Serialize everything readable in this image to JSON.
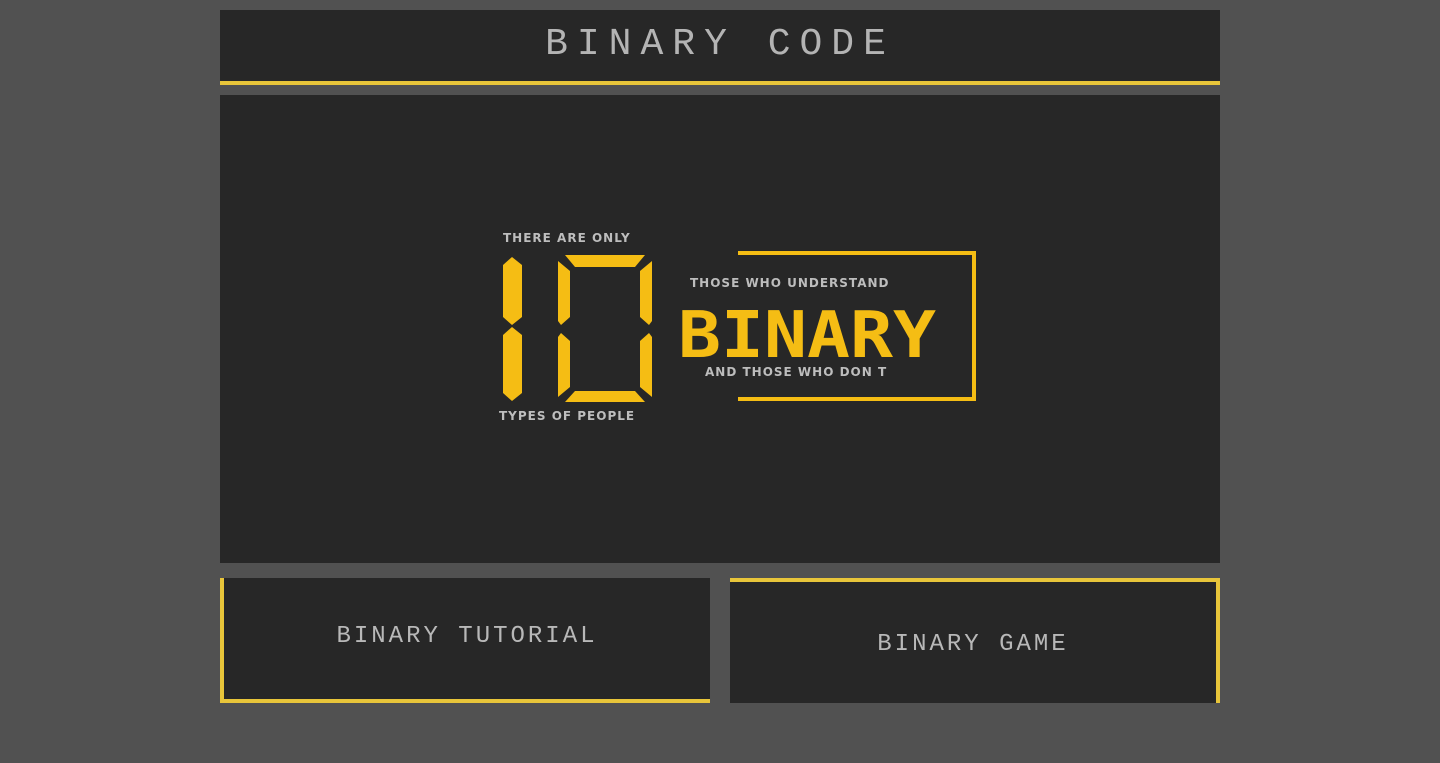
{
  "header": {
    "title": "BINARY CODE"
  },
  "hero": {
    "top_line": "THERE ARE ONLY",
    "big_number": "10",
    "bottom_line": "TYPES OF PEOPLE",
    "box_top": "THOSE WHO UNDERSTAND",
    "box_word": "BINARY",
    "box_bottom": "AND THOSE WHO DON T"
  },
  "buttons": {
    "tutorial": "BINARY TUTORIAL",
    "game": "BINARY GAME"
  },
  "colors": {
    "background": "#515151",
    "panel": "#272727",
    "accent": "#e8c53a",
    "lcd_yellow": "#f5bd14",
    "text": "#b4b4b4"
  }
}
